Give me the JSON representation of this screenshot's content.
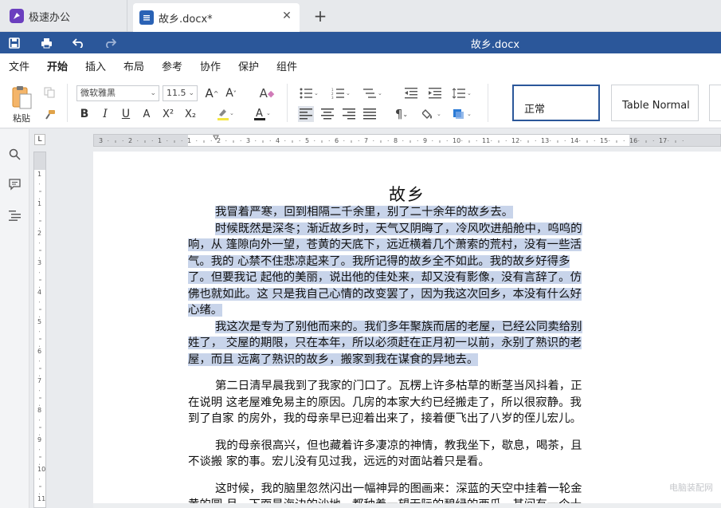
{
  "tabs": {
    "home": {
      "label": "极速办公"
    },
    "document": {
      "label": "故乡.docx*"
    },
    "close_symbol": "✕",
    "add_symbol": "+"
  },
  "titlebar": {
    "title": "故乡.docx"
  },
  "menu": {
    "items": [
      "文件",
      "开始",
      "插入",
      "布局",
      "参考",
      "协作",
      "保护",
      "组件"
    ],
    "active": "开始"
  },
  "toolbar": {
    "paste_label": "粘贴",
    "font_name": "微软雅黑",
    "font_size": "11.5",
    "bold": "B",
    "italic": "I",
    "underline": "U",
    "strikethrough": "A",
    "superscript": "X²",
    "subscript": "X₂",
    "font_grow": "A^",
    "font_shrink": "A˅",
    "styles": [
      "正常",
      "Table Normal"
    ],
    "accent_color": "#2b579a",
    "highlight_color": "#f5e642",
    "font_color": "#d32f2f"
  },
  "ruler": {
    "top_ticks": [
      "3",
      "2",
      "1",
      "1",
      "2",
      "3",
      "4",
      "5",
      "6",
      "7",
      "8",
      "9",
      "10",
      "11",
      "12",
      "13",
      "14",
      "15",
      "16",
      "17"
    ],
    "side_ticks": [
      "1",
      "1",
      "2",
      "3",
      "4",
      "5",
      "6",
      "7",
      "8",
      "9",
      "10",
      "11"
    ],
    "corner_symbol": "L"
  },
  "document": {
    "heading": "故乡",
    "lines": [
      {
        "text": "我冒着严寒，回到相隔二千余里，别了二十余年的故乡去。",
        "indent": true,
        "selected": true,
        "gap_after": false
      },
      {
        "text": "时候既然是深冬；渐近故乡时，天气又阴晦了，冷风吹进船舱中，呜呜的",
        "indent": true,
        "selected": true,
        "gap_after": false
      },
      {
        "text": "响，从 篷隙向外一望，苍黄的天底下，远近横着几个萧索的荒村，没有一些活",
        "indent": false,
        "selected": true,
        "gap_after": false
      },
      {
        "text": "气。我的 心禁不住悲凉起来了。我所记得的故乡全不如此。我的故乡好得多",
        "indent": false,
        "selected": true,
        "gap_after": false
      },
      {
        "text": "了。但要我记 起他的美丽，说出他的佳处来，却又没有影像，没有言辞了。仿",
        "indent": false,
        "selected": true,
        "gap_after": false
      },
      {
        "text": "佛也就如此。这 只是我自己心情的改变罢了，因为我这次回乡，本没有什么好",
        "indent": false,
        "selected": true,
        "gap_after": false
      },
      {
        "text": "心绪。",
        "indent": false,
        "selected": true,
        "gap_after": false
      },
      {
        "text": "我这次是专为了别他而来的。我们多年聚族而居的老屋，已经公同卖给别",
        "indent": true,
        "selected": true,
        "gap_after": false
      },
      {
        "text": "姓了， 交屋的期限，只在本年，所以必须赶在正月初一以前，永别了熟识的老",
        "indent": false,
        "selected": true,
        "gap_after": false
      },
      {
        "text": "屋，而且 远离了熟识的故乡，搬家到我在谋食的异地去。",
        "indent": false,
        "selected": true,
        "gap_after": true
      },
      {
        "text": "第二日清早晨我到了我家的门口了。瓦楞上许多枯草的断茎当风抖着，正",
        "indent": true,
        "selected": false,
        "gap_after": false
      },
      {
        "text": "在说明 这老屋难免易主的原因。几房的本家大约已经搬走了，所以很寂静。我",
        "indent": false,
        "selected": false,
        "gap_after": false
      },
      {
        "text": "到了自家 的房外，我的母亲早已迎着出来了，接着便飞出了八岁的侄儿宏儿。",
        "indent": false,
        "selected": false,
        "gap_after": true
      },
      {
        "text": "我的母亲很高兴，但也藏着许多凄凉的神情，教我坐下，歇息，喝茶，且",
        "indent": true,
        "selected": false,
        "gap_after": false
      },
      {
        "text": "不谈搬 家的事。宏儿没有见过我，远远的对面站着只是看。",
        "indent": false,
        "selected": false,
        "gap_after": true
      },
      {
        "text": "这时候，我的脑里忽然闪出一幅神异的图画来：深蓝的天空中挂着一轮金",
        "indent": true,
        "selected": false,
        "gap_after": false
      },
      {
        "text": "黄的圆 月，下面是海边的沙地，都种着一望无际的碧绿的西瓜，其间有一个十",
        "indent": false,
        "selected": false,
        "gap_after": false
      }
    ],
    "selection_color": "#c8d4ea"
  },
  "watermark": "电脑装配网"
}
